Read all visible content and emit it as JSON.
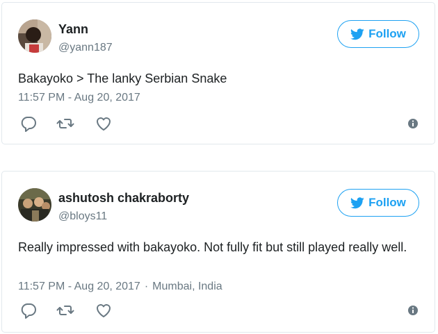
{
  "tweets": [
    {
      "display_name": "Yann",
      "handle": "@yann187",
      "follow_label": "Follow",
      "text": "Bakayoko > The lanky Serbian Snake",
      "time": "11:57 PM - Aug 20, 2017",
      "location": "",
      "icons": [
        "reply-icon",
        "retweet-icon",
        "like-icon",
        "info-icon"
      ]
    },
    {
      "display_name": "ashutosh chakraborty",
      "handle": "@bloys11",
      "follow_label": "Follow",
      "text": "Really impressed with bakayoko. Not fully fit but still played really well.",
      "time": "11:57 PM - Aug 20, 2017",
      "separator": "·",
      "location": "Mumbai, India",
      "icons": [
        "reply-icon",
        "retweet-icon",
        "like-icon",
        "info-icon"
      ]
    }
  ],
  "colors": {
    "accent": "#1da1f2",
    "text": "#1c2022",
    "muted": "#697882",
    "border": "#e1e8ed"
  }
}
